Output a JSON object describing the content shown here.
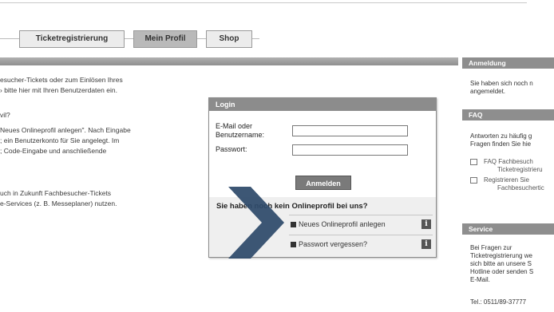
{
  "tabs": [
    {
      "label": "Ticketregistrierung"
    },
    {
      "label": "Mein Profil"
    },
    {
      "label": "Shop"
    }
  ],
  "main": {
    "lines": [
      "esucher-Tickets oder zum Einlösen Ihres",
      "› bitte hier mit Ihren Benutzerdaten ein.",
      "vil?",
      "Neues Onlineprofil anlegen\". Nach Eingabe",
      "; ein Benutzerkonto für Sie angelegt. Im",
      "; Code-Eingabe und anschließende",
      "uch in Zukunft Fachbesucher-Tickets",
      "e-Services (z. B. Messeplaner) nutzen."
    ]
  },
  "sidebar": {
    "anmeldung": {
      "title": "Anmeldung",
      "text": [
        "Sie haben sich noch n",
        "angemeldet."
      ]
    },
    "faq": {
      "title": "FAQ",
      "text": [
        "Antworten zu häufig g",
        "Fragen finden Sie hie"
      ],
      "links": [
        {
          "lines": [
            "FAQ Fachbesuch",
            "Ticketregistrieru"
          ]
        },
        {
          "lines": [
            "Registrieren Sie",
            "Fachbesuchertic"
          ]
        }
      ]
    },
    "service": {
      "title": "Service",
      "text": [
        "Bei Fragen zur",
        "Ticketregistrierung we",
        "sich bitte an unsere S",
        "Hotline oder senden S",
        "E-Mail."
      ],
      "phone": "Tel.: 0511/89-37777"
    }
  },
  "login": {
    "title": "Login",
    "email_label_1": "E-Mail oder",
    "email_label_2": "Benutzername:",
    "password_label": "Passwort:",
    "email_value": "",
    "password_value": "",
    "submit_label": "Anmelden",
    "no_profile_heading": "Sie haben noch kein Onlineprofil bei uns?",
    "new_profile_link": "Neues Onlineprofil anlegen",
    "forgot_password_link": "Passwort vergessen?",
    "info_glyph": "i"
  },
  "colors": {
    "arrow": "#2e4a6b",
    "header_bar": "#8c8c8c"
  }
}
